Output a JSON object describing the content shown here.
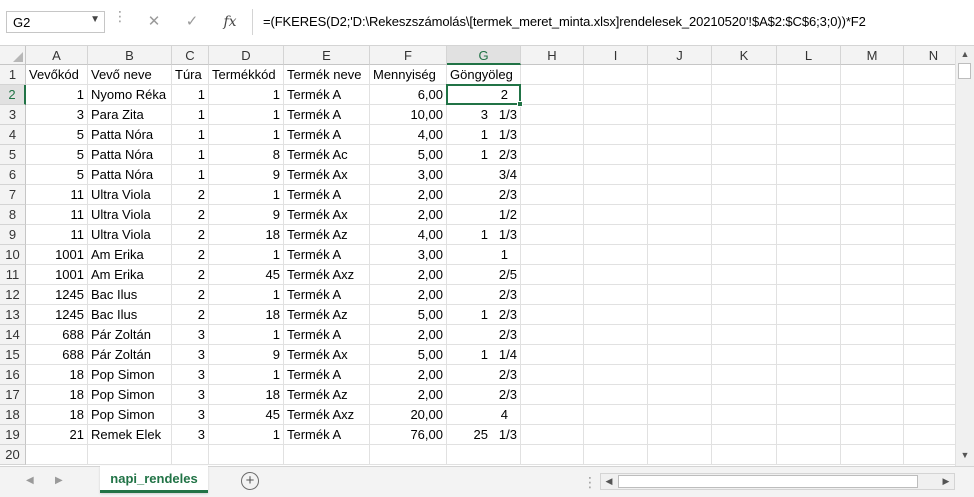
{
  "formula_bar": {
    "name_box": "G2",
    "cancel_icon": "close-icon",
    "enter_icon": "checkmark-icon",
    "fx_label": "fx",
    "formula": "=(FKERES(D2;'D:\\Rekeszszámolás\\[termek_meret_minta.xlsx]rendelesek_20210520'!$A$2:$C$6;3;0))*F2"
  },
  "columns": [
    "A",
    "B",
    "C",
    "D",
    "E",
    "F",
    "G",
    "H",
    "I",
    "J",
    "K",
    "L",
    "M",
    "N"
  ],
  "selected_column": "G",
  "selected_row": "2",
  "row_numbers": [
    "1",
    "2",
    "3",
    "4",
    "5",
    "6",
    "7",
    "8",
    "9",
    "10",
    "11",
    "12",
    "13",
    "14",
    "15",
    "16",
    "17",
    "18",
    "19",
    "20"
  ],
  "headers": [
    "Vevőkód",
    "Vevő neve",
    "Túra",
    "Termékkód",
    "Termék neve",
    "Mennyiség",
    "Göngyöleg"
  ],
  "rows": [
    [
      "1",
      "Nyomo Réka",
      "1",
      "1",
      "Termék A",
      "6,00",
      "2",
      ""
    ],
    [
      "3",
      "Para Zita",
      "1",
      "1",
      "Termék A",
      "10,00",
      "3",
      "1/3"
    ],
    [
      "5",
      "Patta Nóra",
      "1",
      "1",
      "Termék A",
      "4,00",
      "1",
      "1/3"
    ],
    [
      "5",
      "Patta Nóra",
      "1",
      "8",
      "Termék Ac",
      "5,00",
      "1",
      "2/3"
    ],
    [
      "5",
      "Patta Nóra",
      "1",
      "9",
      "Termék Ax",
      "3,00",
      "",
      "3/4"
    ],
    [
      "11",
      "Ultra Viola",
      "2",
      "1",
      "Termék A",
      "2,00",
      "",
      "2/3"
    ],
    [
      "11",
      "Ultra Viola",
      "2",
      "9",
      "Termék Ax",
      "2,00",
      "",
      "1/2"
    ],
    [
      "11",
      "Ultra Viola",
      "2",
      "18",
      "Termék Az",
      "4,00",
      "1",
      "1/3"
    ],
    [
      "1001",
      "Am Erika",
      "2",
      "1",
      "Termék A",
      "3,00",
      "1",
      ""
    ],
    [
      "1001",
      "Am Erika",
      "2",
      "45",
      "Termék Axz",
      "2,00",
      "",
      "2/5"
    ],
    [
      "1245",
      "Bac Ilus",
      "2",
      "1",
      "Termék A",
      "2,00",
      "",
      "2/3"
    ],
    [
      "1245",
      "Bac Ilus",
      "2",
      "18",
      "Termék Az",
      "5,00",
      "1",
      "2/3"
    ],
    [
      "688",
      "Pár Zoltán",
      "3",
      "1",
      "Termék A",
      "2,00",
      "",
      "2/3"
    ],
    [
      "688",
      "Pár Zoltán",
      "3",
      "9",
      "Termék Ax",
      "5,00",
      "1",
      "1/4"
    ],
    [
      "18",
      "Pop Simon",
      "3",
      "1",
      "Termék A",
      "2,00",
      "",
      "2/3"
    ],
    [
      "18",
      "Pop Simon",
      "3",
      "18",
      "Termék Az",
      "2,00",
      "",
      "2/3"
    ],
    [
      "18",
      "Pop Simon",
      "3",
      "45",
      "Termék Axz",
      "20,00",
      "4",
      ""
    ],
    [
      "21",
      "Remek Elek",
      "3",
      "1",
      "Termék A",
      "76,00",
      "25",
      "1/3"
    ]
  ],
  "sheet_tab": "napi_rendeles",
  "add_sheet_icon": "plus-circle-icon",
  "colors": {
    "accent": "#217346",
    "header_bg": "#f3f3f3",
    "gridline": "#e1e1e1"
  }
}
